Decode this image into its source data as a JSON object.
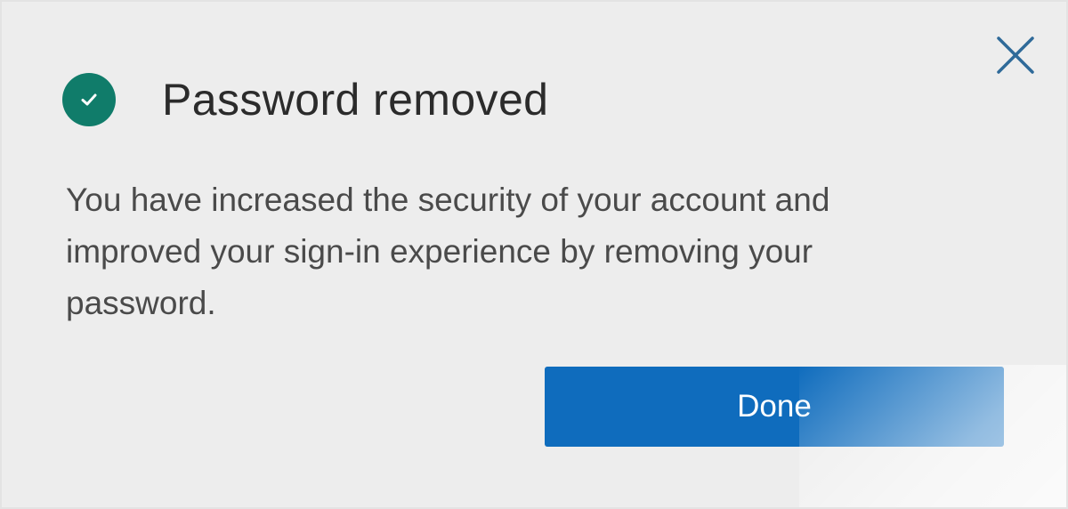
{
  "dialog": {
    "title": "Password removed",
    "message": "You have increased the security of your account and improved your sign-in experience by removing your password.",
    "done_label": "Done",
    "status_icon": "check-circle-icon",
    "close_icon": "close-icon"
  },
  "colors": {
    "accent": "#0f6cbd",
    "success": "#107c6a",
    "background": "#ededed"
  }
}
